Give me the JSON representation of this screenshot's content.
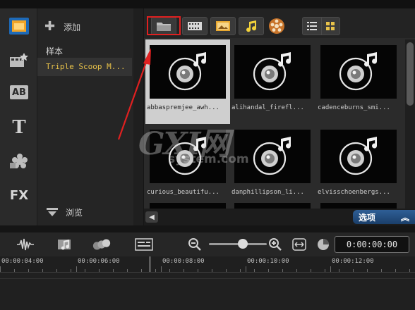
{
  "rail": {
    "items": [
      {
        "name": "media"
      },
      {
        "name": "instant-project"
      },
      {
        "name": "title-ab"
      },
      {
        "name": "text"
      },
      {
        "name": "graphics"
      },
      {
        "name": "filters"
      }
    ],
    "title_glyph": "T",
    "ab_glyph": "AB",
    "fx_label": "FX"
  },
  "library": {
    "add_label": "添加",
    "folders": [
      "样本",
      "Triple Scoop M..."
    ],
    "browse_label": "浏览"
  },
  "toolbar": {
    "buttons": [
      "folder",
      "video",
      "photo",
      "audio",
      "web-audio"
    ],
    "views": [
      "list",
      "thumbnail"
    ]
  },
  "media": {
    "items": [
      {
        "name": "abbaspremjee_awh...",
        "selected": true
      },
      {
        "name": "alihandal_firefl..."
      },
      {
        "name": "cadenceburns_smi..."
      },
      {
        "name": "curious_beautifu..."
      },
      {
        "name": "danphillipson_li..."
      },
      {
        "name": "elvisschoenbergs..."
      }
    ]
  },
  "options": {
    "label": "选项",
    "chevron": "︽"
  },
  "timeline": {
    "timecode": "0:00:00:00",
    "ticks": [
      "00:00:04:00",
      "00:00:06:00",
      "00:00:08:00",
      "00:00:10:00",
      "00:00:12:00"
    ]
  },
  "watermark": {
    "big": "GXI网",
    "small": "system.com"
  },
  "colors": {
    "accent_red": "#e02020",
    "folder_yellow": "#e8c24a",
    "options_blue": "#2f5f96"
  }
}
